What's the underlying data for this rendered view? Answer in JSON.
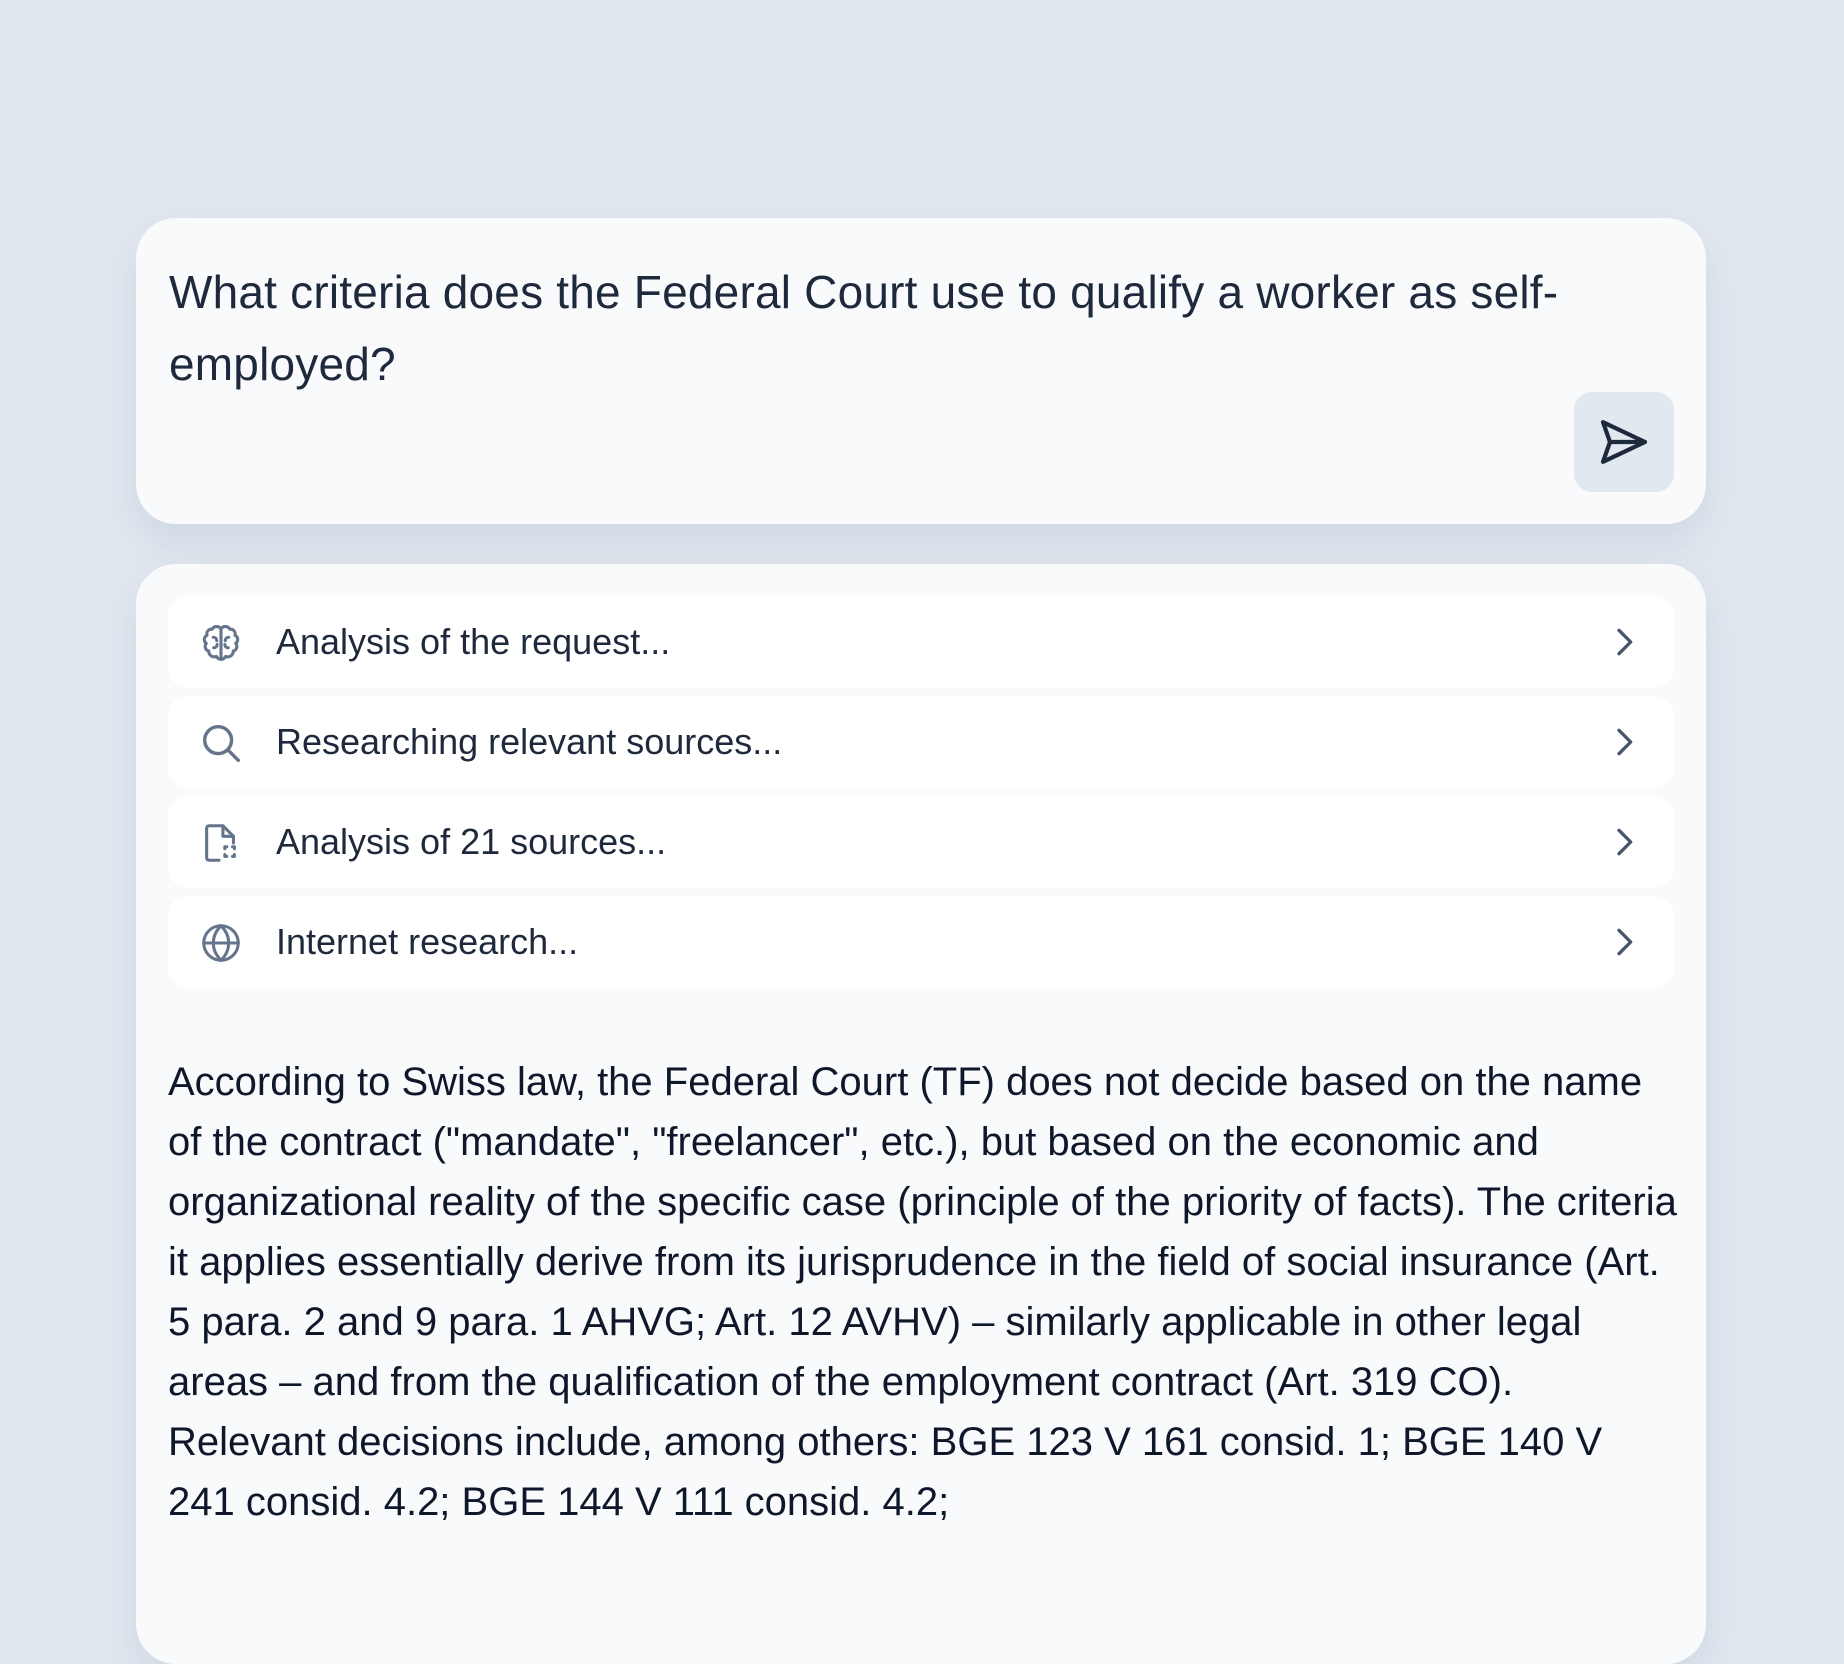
{
  "query": {
    "text": "What criteria does the Federal Court use to qualify a worker as self-employed?"
  },
  "send_button": {
    "icon": "send-icon"
  },
  "steps": [
    {
      "icon": "brain-icon",
      "label": "Analysis of the request..."
    },
    {
      "icon": "search-icon",
      "label": "Researching relevant sources..."
    },
    {
      "icon": "document-scan-icon",
      "label": "Analysis of 21 sources..."
    },
    {
      "icon": "globe-icon",
      "label": "Internet research..."
    }
  ],
  "answer": {
    "text": "According to Swiss law, the Federal Court (TF) does not decide based on the name of the contract (\"mandate\", \"freelancer\", etc.), but based on the economic and organizational reality of the specific case (principle of the priority of facts). The criteria it applies essentially derive from its jurisprudence in the field of social insurance (Art. 5 para. 2 and 9 para. 1 AHVG; Art. 12 AVHV) – similarly applicable in other legal areas – and from the qualification of the employment contract (Art. 319 CO). Relevant decisions include, among others: BGE 123 V 161 consid. 1; BGE 140 V 241 consid. 4.2; BGE 144 V 111 consid. 4.2;"
  },
  "colors": {
    "background": "#e2e8f0",
    "card": "#f8fafc",
    "row": "#ffffff",
    "text": "#1e293b",
    "icon": "#64748b"
  }
}
